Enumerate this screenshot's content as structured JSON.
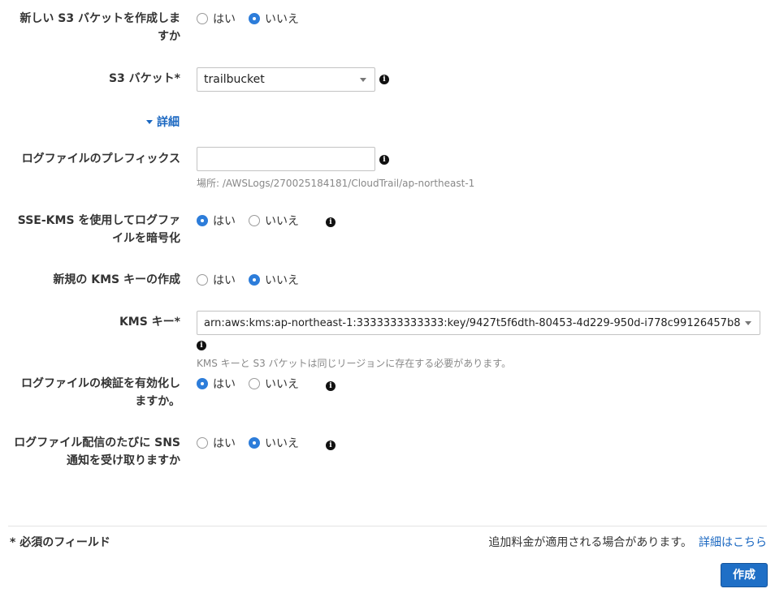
{
  "yes_label": "はい",
  "no_label": "いいえ",
  "new_bucket": {
    "label_line1": "新しい S3 バケットを作成しま",
    "label_line2": "すか",
    "selected": "no"
  },
  "s3_bucket": {
    "label": "S3 バケット*",
    "value": "trailbucket"
  },
  "details_toggle": "詳細",
  "log_prefix": {
    "label": "ログファイルのプレフィックス",
    "value": "",
    "placeholder": "",
    "hint": "場所: /AWSLogs/270025184181/CloudTrail/ap-northeast-1"
  },
  "sse_kms": {
    "label_line1": "SSE-KMS を使用してログファ",
    "label_line2": "イルを暗号化",
    "selected": "yes"
  },
  "new_kms_key": {
    "label": "新規の KMS キーの作成",
    "selected": "no"
  },
  "kms_key": {
    "label": "KMS キー*",
    "value": "arn:aws:kms:ap-northeast-1:3333333333333:key/9427t5f6dth-80453-4d229-950d-i778c99126457b8",
    "hint": "KMS キーと S3 バケットは同じリージョンに存在する必要があります。"
  },
  "log_validation": {
    "label_line1": "ログファイルの検証を有効化し",
    "label_line2": "ますか。",
    "selected": "yes"
  },
  "sns_notify": {
    "label_line1": "ログファイル配信のたびに SNS",
    "label_line2": "通知を受け取りますか",
    "selected": "no"
  },
  "footer": {
    "required_note": "* 必須のフィールド",
    "charges_note": "追加料金が適用される場合があります。",
    "details_link": "詳細はこちら",
    "create_button": "作成"
  },
  "icons": {
    "info": "info-icon",
    "caret": "caret-down-icon"
  },
  "colors": {
    "accent": "#2d7dda",
    "link": "#1a67c1",
    "button": "#1f6fc6"
  }
}
